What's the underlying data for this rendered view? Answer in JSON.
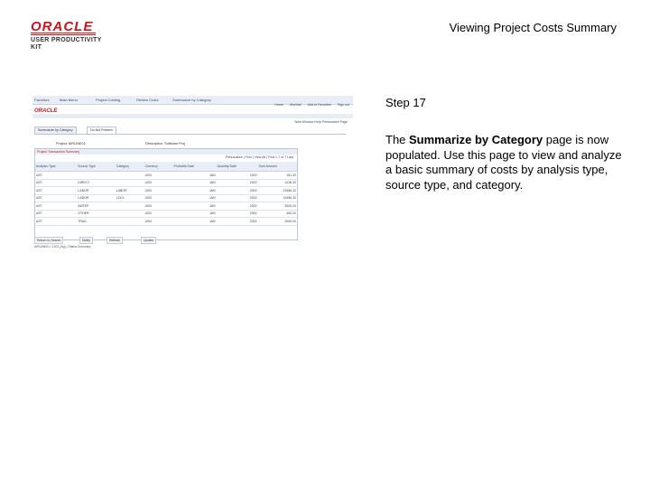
{
  "logo": {
    "brand": "ORACLE",
    "product": "USER PRODUCTIVITY KIT"
  },
  "page_title": "Viewing Project Costs Summary",
  "step": "Step 17",
  "description": {
    "prefix": "The ",
    "bold": "Summarize by Category",
    "suffix": " page is now populated. Use this page to view and analyze a basic summary of costs by analysis type, source type, and category."
  },
  "screenshot": {
    "topnav": [
      "Favorites",
      "Main Menu",
      "Project Costing",
      "Review Costs",
      "Summarize by Category"
    ],
    "logo": "ORACLE",
    "toplinks": [
      "Home",
      "Worklist",
      "Add to Favorites",
      "Sign out"
    ],
    "subright": "New Window   Help   Personalize Page",
    "tabs": [
      "Summarize by Category",
      "Do Not Present"
    ],
    "fields": {
      "project_label": "Project:",
      "project_value": "AIRLINE01",
      "desc_label": "Description:",
      "desc_value": "Software Proj"
    },
    "grid_title": "Project Transaction Summary",
    "grid_nav": "Personalize | Find | View All |   First  1-7 of 7  Last",
    "headers": [
      "Analysis Type",
      "Source Type",
      "Category",
      "Currency",
      "Probable Date",
      "Quantity Date",
      "Sum Amount"
    ],
    "rows": [
      [
        "AST",
        "",
        "",
        "USD",
        "JAN",
        "2002",
        "161.32"
      ],
      [
        "AST",
        "DIRECT",
        "",
        "USD",
        "JAN",
        "2002",
        "1416.32"
      ],
      [
        "AST",
        "LABOR",
        "LABOR",
        "USD",
        "JAN",
        "2002",
        "23456.32"
      ],
      [
        "AST",
        "LABOR",
        "LOCL",
        "USD",
        "JAN",
        "2002",
        "10456.32"
      ],
      [
        "AST",
        "AMTEP",
        "",
        "USD",
        "JAN",
        "2002",
        "3000.00"
      ],
      [
        "AST",
        "OTHER",
        "",
        "USD",
        "JAN",
        "2002",
        "400.00"
      ],
      [
        "AST",
        "TRAD",
        "",
        "USD",
        "JAN",
        "2002",
        "2000.00"
      ]
    ],
    "buttons": [
      "Return to Search",
      "Notify",
      "Refresh",
      "Update"
    ],
    "footer": "AIRLINE01 / 1202 (Ag) | Status Summary"
  }
}
